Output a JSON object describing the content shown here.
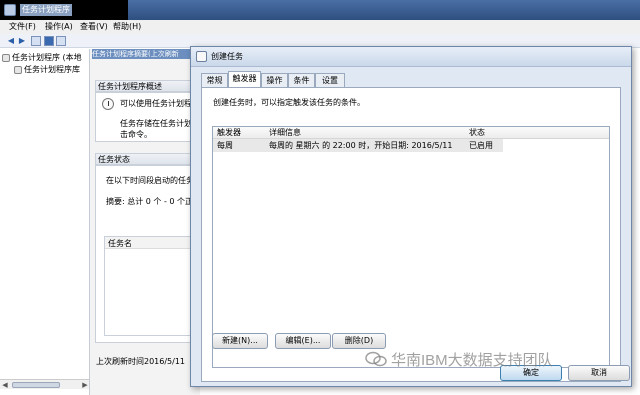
{
  "main_window": {
    "title": "任务计划程序",
    "menu": [
      "文件(F)",
      "操作(A)",
      "查看(V)",
      "帮助(H)"
    ],
    "tree": {
      "root": "任务计划程序 (本地",
      "child": "任务计划程序库"
    },
    "center": {
      "header": "任务计划程序摘要(上次刷新",
      "overview_title": "任务计划程序概述",
      "overview_line1": "可以使用任务计划程",
      "overview_line2": "任务存储在任务计划",
      "overview_line3": "击命令。",
      "status_title": "任务状态",
      "status_desc": "在以下时间段启动的任务",
      "summary": "摘要: 总计 0 个 - 0 个正",
      "task_name_header": "任务名"
    },
    "status_bar": "上次刷新时间2016/5/11"
  },
  "dialog": {
    "title": "创建任务",
    "tabs": [
      "常规",
      "触发器",
      "操作",
      "条件",
      "设置"
    ],
    "active_tab": "触发器",
    "description": "创建任务时，可以指定触发该任务的条件。",
    "grid": {
      "columns": [
        "触发器",
        "详细信息",
        "状态"
      ],
      "rows": [
        {
          "trigger": "每周",
          "details": "每周的 星期六 的 22:00 时，开始日期: 2016/5/11",
          "status": "已启用"
        }
      ]
    },
    "buttons": {
      "new": "新建(N)...",
      "edit": "编辑(E)...",
      "delete": "删除(D)",
      "ok": "确定",
      "cancel": "取消"
    }
  },
  "watermark": "华南IBM大数据支持团队"
}
